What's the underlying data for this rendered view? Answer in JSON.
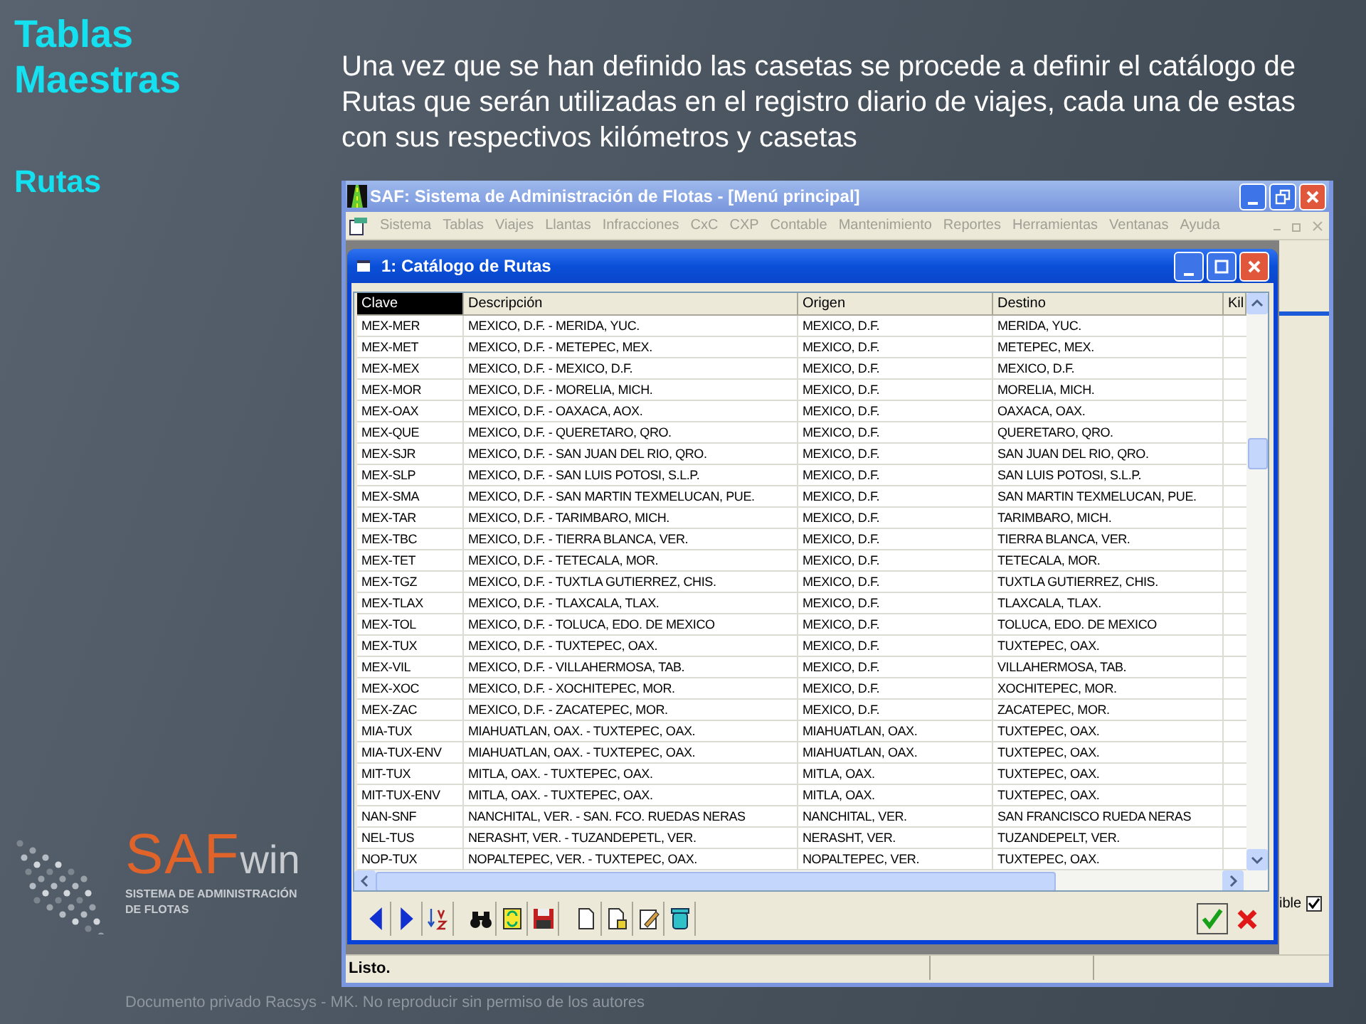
{
  "slide": {
    "title": "Tablas Maestras",
    "subtitle": "Rutas",
    "text": "Una vez que se han definido las casetas se procede a definir el catálogo de Rutas que serán utilizadas en el registro diario de viajes, cada una de estas con sus respectivos kilómetros y casetas",
    "footer": "Documento privado Racsys - MK. No reproducir sin permiso de los autores"
  },
  "logo": {
    "brand": "SAF",
    "suffix": "win",
    "tagline": [
      "SISTEMA DE ADMINISTRACIÓN",
      "DE FLOTAS"
    ]
  },
  "window": {
    "title": "SAF: Sistema de Administración de Flotas - [Menú principal]"
  },
  "menu": [
    {
      "label": "Sistema",
      "disabled": true
    },
    {
      "label": "Tablas",
      "disabled": true
    },
    {
      "label": "Viajes",
      "disabled": true
    },
    {
      "label": "Llantas",
      "disabled": true
    },
    {
      "label": "Infracciones",
      "disabled": true
    },
    {
      "label": "CxC",
      "disabled": true
    },
    {
      "label": "CXP",
      "disabled": true
    },
    {
      "label": "Contable",
      "disabled": true
    },
    {
      "label": "Mantenimiento",
      "disabled": true
    },
    {
      "label": "Reportes",
      "disabled": true
    },
    {
      "label": "Herramientas",
      "disabled": true
    },
    {
      "label": "Ventanas",
      "disabled": true
    },
    {
      "label": "Ayuda",
      "disabled": true
    }
  ],
  "child_window": {
    "title": "1: Catálogo de Rutas"
  },
  "table": {
    "columns": [
      {
        "label": "Clave",
        "selected": true
      },
      {
        "label": "Descripción",
        "selected": false
      },
      {
        "label": "Origen",
        "selected": false
      },
      {
        "label": "Destino",
        "selected": false
      },
      {
        "label": "Kil",
        "selected": false
      }
    ],
    "rows": [
      [
        "MEX-MER",
        "MEXICO, D.F. - MERIDA, YUC.",
        "MEXICO, D.F.",
        "MERIDA, YUC."
      ],
      [
        "MEX-MET",
        "MEXICO, D.F. - METEPEC, MEX.",
        "MEXICO, D.F.",
        "METEPEC, MEX."
      ],
      [
        "MEX-MEX",
        "MEXICO, D.F. - MEXICO, D.F.",
        "MEXICO, D.F.",
        "MEXICO, D.F."
      ],
      [
        "MEX-MOR",
        "MEXICO, D.F. - MORELIA, MICH.",
        "MEXICO, D.F.",
        "MORELIA, MICH."
      ],
      [
        "MEX-OAX",
        "MEXICO, D.F. - OAXACA, AOX.",
        "MEXICO, D.F.",
        "OAXACA, OAX."
      ],
      [
        "MEX-QUE",
        "MEXICO, D.F. - QUERETARO, QRO.",
        "MEXICO, D.F.",
        "QUERETARO, QRO."
      ],
      [
        "MEX-SJR",
        "MEXICO, D.F. - SAN JUAN DEL RIO, QRO.",
        "MEXICO, D.F.",
        "SAN JUAN DEL RIO, QRO."
      ],
      [
        "MEX-SLP",
        "MEXICO, D.F. - SAN LUIS POTOSI, S.L.P.",
        "MEXICO, D.F.",
        "SAN LUIS POTOSI, S.L.P."
      ],
      [
        "MEX-SMA",
        "MEXICO, D.F. - SAN MARTIN TEXMELUCAN, PUE.",
        "MEXICO, D.F.",
        "SAN MARTIN TEXMELUCAN, PUE."
      ],
      [
        "MEX-TAR",
        "MEXICO, D.F. - TARIMBARO, MICH.",
        "MEXICO, D.F.",
        "TARIMBARO, MICH."
      ],
      [
        "MEX-TBC",
        "MEXICO, D.F. - TIERRA BLANCA, VER.",
        "MEXICO, D.F.",
        "TIERRA BLANCA, VER."
      ],
      [
        "MEX-TET",
        "MEXICO, D.F. - TETECALA, MOR.",
        "MEXICO, D.F.",
        "TETECALA, MOR."
      ],
      [
        "MEX-TGZ",
        "MEXICO, D.F. - TUXTLA GUTIERREZ, CHIS.",
        "MEXICO, D.F.",
        "TUXTLA GUTIERREZ, CHIS."
      ],
      [
        "MEX-TLAX",
        "MEXICO, D.F. - TLAXCALA, TLAX.",
        "MEXICO, D.F.",
        "TLAXCALA, TLAX."
      ],
      [
        "MEX-TOL",
        "MEXICO, D.F. - TOLUCA, EDO. DE MEXICO",
        "MEXICO, D.F.",
        "TOLUCA, EDO. DE MEXICO"
      ],
      [
        "MEX-TUX",
        "MEXICO, D.F. - TUXTEPEC, OAX.",
        "MEXICO, D.F.",
        "TUXTEPEC, OAX."
      ],
      [
        "MEX-VIL",
        "MEXICO, D.F. - VILLAHERMOSA, TAB.",
        "MEXICO, D.F.",
        "VILLAHERMOSA, TAB."
      ],
      [
        "MEX-XOC",
        "MEXICO, D.F. - XOCHITEPEC, MOR.",
        "MEXICO, D.F.",
        "XOCHITEPEC, MOR."
      ],
      [
        "MEX-ZAC",
        "MEXICO, D.F. - ZACATEPEC, MOR.",
        "MEXICO, D.F.",
        "ZACATEPEC, MOR."
      ],
      [
        "MIA-TUX",
        "MIAHUATLAN, OAX. - TUXTEPEC, OAX.",
        "MIAHUATLAN, OAX.",
        "TUXTEPEC, OAX."
      ],
      [
        "MIA-TUX-ENV",
        "MIAHUATLAN, OAX. - TUXTEPEC, OAX.",
        "MIAHUATLAN, OAX.",
        "TUXTEPEC, OAX."
      ],
      [
        "MIT-TUX",
        "MITLA, OAX. - TUXTEPEC, OAX.",
        "MITLA, OAX.",
        "TUXTEPEC, OAX."
      ],
      [
        "MIT-TUX-ENV",
        "MITLA, OAX. - TUXTEPEC, OAX.",
        "MITLA, OAX.",
        "TUXTEPEC, OAX."
      ],
      [
        "NAN-SNF",
        "NANCHITAL, VER. - SAN. FCO. RUEDAS NERAS",
        "NANCHITAL, VER.",
        "SAN FRANCISCO RUEDA NERAS"
      ],
      [
        "NEL-TUS",
        "NERASHT, VER. - TUZANDEPETL, VER.",
        "NERASHT, VER.",
        "TUZANDEPELT, VER."
      ],
      [
        "NOP-TUX",
        "NOPALTEPEC, VER. - TUXTEPEC, OAX.",
        "NOPALTEPEC, VER.",
        "TUXTEPEC, OAX."
      ]
    ]
  },
  "side_panel": {
    "label": "ible",
    "checked": true
  },
  "status_bar": {
    "text": "Listo."
  }
}
